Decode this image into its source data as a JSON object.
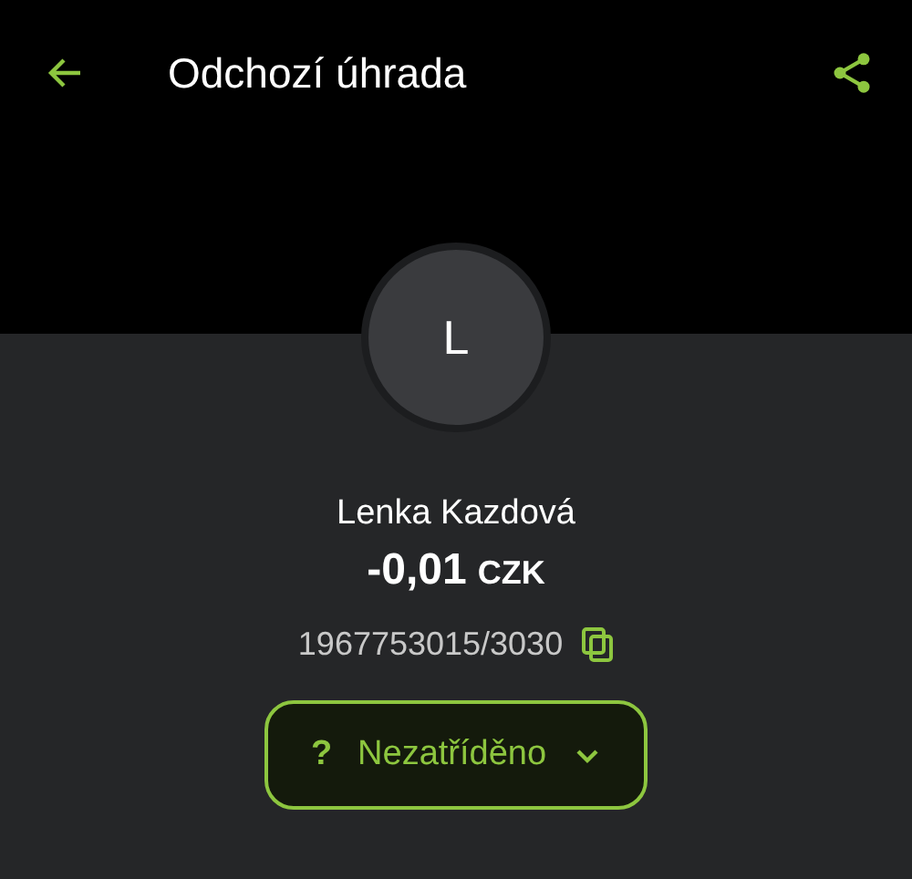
{
  "header": {
    "title": "Odchozí úhrada"
  },
  "contact": {
    "initial": "L",
    "name": "Lenka Kazdová",
    "amount": "-0,01",
    "currency": "CZK",
    "account": "1967753015/3030"
  },
  "category": {
    "icon": "?",
    "label": "Nezatříděno"
  }
}
